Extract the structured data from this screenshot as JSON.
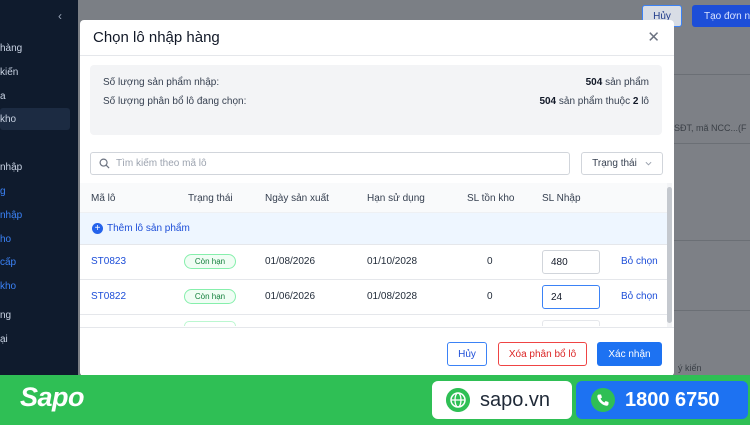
{
  "background": {
    "sidebar_items": [
      {
        "label": "hàng",
        "active": false
      },
      {
        "label": "kiến",
        "active": false
      },
      {
        "label": "a",
        "active": false
      },
      {
        "label": "kho",
        "active": false
      },
      {
        "label": "nhập",
        "active": false
      },
      {
        "label": "g",
        "active": true
      },
      {
        "label": "nhập",
        "active": true
      },
      {
        "label": "ho",
        "active": true
      },
      {
        "label": "cấp",
        "active": true
      },
      {
        "label": "kho",
        "active": true
      },
      {
        "label": "ng",
        "active": false
      },
      {
        "label": "ại",
        "active": false
      }
    ],
    "collapse_icon": "chevron-left-icon",
    "header_cancel_label": "Hủy",
    "header_create_label": "Tạo đơn n",
    "search_hint": "SĐT, mã NCC...(F",
    "note_fragment": "ý kiến"
  },
  "modal": {
    "title": "Chọn lô nhập hàng",
    "close_icon": "close-icon",
    "summary": {
      "qty_label": "Số lượng sản phẩm nhập:",
      "qty_value_number": "504",
      "qty_value_unit": "sản phẩm",
      "alloc_label": "Số lượng phân bổ lô đang chọn:",
      "alloc_value_number": "504",
      "alloc_value_middle": "sản phẩm thuộc",
      "alloc_value_lots": "2",
      "alloc_value_unit": "lô"
    },
    "search": {
      "placeholder": "Tìm kiếm theo mã lô",
      "icon": "search-icon"
    },
    "status_filter": {
      "label": "Trạng thái",
      "icon": "chevron-down-icon"
    },
    "table": {
      "headers": [
        "Mã lô",
        "Trạng thái",
        "Ngày sản xuất",
        "Hạn sử dụng",
        "SL tồn kho",
        "SL Nhập"
      ],
      "add_lot_label": "Thêm lô sản phẩm",
      "rows": [
        {
          "code": "ST0823",
          "status": "Còn hạn",
          "mfg_date": "01/08/2026",
          "exp_date": "01/10/2028",
          "stock": "0",
          "qty": "480",
          "action": "Bỏ chọn"
        },
        {
          "code": "ST0822",
          "status": "Còn hạn",
          "mfg_date": "01/06/2026",
          "exp_date": "01/08/2028",
          "stock": "0",
          "qty": "24",
          "action": "Bỏ chọn"
        }
      ]
    },
    "footer": {
      "cancel_label": "Hủy",
      "clear_label": "Xóa phân bổ lô",
      "confirm_label": "Xác nhận"
    }
  },
  "banner": {
    "brand": "Sapo",
    "website": "sapo.vn",
    "website_icon": "globe-icon",
    "phone": "1800 6750",
    "phone_icon": "phone-icon",
    "colors": {
      "banner_green": "#2fbf55",
      "phone_blue": "#1d72f2"
    }
  }
}
